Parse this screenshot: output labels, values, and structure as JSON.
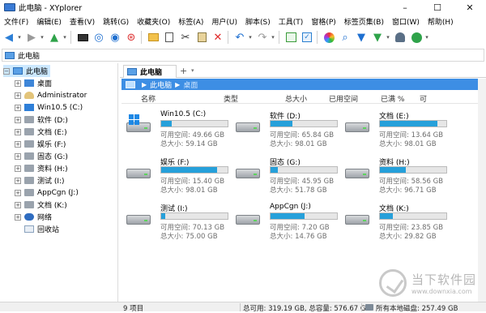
{
  "window": {
    "title": "此电脑 - XYplorer",
    "controls": [
      "–",
      "☐",
      "✕"
    ]
  },
  "menu": [
    "文件(F)",
    "编辑(E)",
    "查看(V)",
    "跳转(G)",
    "收藏夹(O)",
    "标签(A)",
    "用户(U)",
    "脚本(S)",
    "工具(T)",
    "窗格(P)",
    "标签页集(B)",
    "窗口(W)",
    "帮助(H)"
  ],
  "toolbar_icons": [
    "back-arrow-icon",
    "forward-arrow-icon",
    "up-arrow-icon",
    "computer-icon",
    "target-icon",
    "find-icon",
    "new-folder-icon",
    "copy-icon",
    "cut-icon",
    "paste-icon",
    "delete-icon",
    "undo-icon",
    "redo-icon",
    "tree-toggle-icon",
    "checkbox-icon",
    "color-wheel-icon",
    "search-icon",
    "filter-icon",
    "filter-green-icon",
    "ghost-icon",
    "visual-filter-icon"
  ],
  "address": {
    "path": "此电脑"
  },
  "tree": {
    "items": [
      {
        "label": "此电脑",
        "icon": "computer-icon",
        "expand": "−",
        "level": 0,
        "selected": true
      },
      {
        "label": "桌面",
        "icon": "desktop-icon",
        "expand": "+",
        "level": 1
      },
      {
        "label": "Administrator",
        "icon": "user-folder-icon",
        "expand": "+",
        "level": 1
      },
      {
        "label": "Win10.5 (C:)",
        "icon": "windows-drive-icon",
        "expand": "+",
        "level": 1
      },
      {
        "label": "软件 (D:)",
        "icon": "drive-icon",
        "expand": "+",
        "level": 1
      },
      {
        "label": "文档 (E:)",
        "icon": "drive-icon",
        "expand": "+",
        "level": 1
      },
      {
        "label": "娱乐 (F:)",
        "icon": "drive-icon",
        "expand": "+",
        "level": 1
      },
      {
        "label": "固态 (G:)",
        "icon": "drive-icon",
        "expand": "+",
        "level": 1
      },
      {
        "label": "资料 (H:)",
        "icon": "drive-icon",
        "expand": "+",
        "level": 1
      },
      {
        "label": "测试 (I:)",
        "icon": "drive-icon",
        "expand": "+",
        "level": 1
      },
      {
        "label": "AppCgn (J:)",
        "icon": "drive-icon",
        "expand": "+",
        "level": 1
      },
      {
        "label": "文档 (K:)",
        "icon": "drive-icon",
        "expand": "+",
        "level": 1
      },
      {
        "label": "网络",
        "icon": "network-icon",
        "expand": "+",
        "level": 1
      },
      {
        "label": "回收站",
        "icon": "recycle-bin-icon",
        "expand": "",
        "level": 1
      }
    ]
  },
  "tabs": [
    {
      "label": "此电脑"
    }
  ],
  "tab_add": "+",
  "tab_add_menu": "▾",
  "breadcrumb": {
    "root": "此电脑",
    "current": "桌面"
  },
  "columns": [
    "名称",
    "类型",
    "总大小",
    "已用空间",
    "已满 %",
    "可"
  ],
  "drives": [
    {
      "name": "Win10.5 (C:)",
      "free": "可用空间: 49.66 GB",
      "total": "总大小: 59.14 GB",
      "used_fraction": 0.16,
      "windows": true
    },
    {
      "name": "软件 (D:)",
      "free": "可用空间: 65.84 GB",
      "total": "总大小: 98.01 GB",
      "used_fraction": 0.33
    },
    {
      "name": "文档 (E:)",
      "free": "可用空间: 13.64 GB",
      "total": "总大小: 98.01 GB",
      "used_fraction": 0.86
    },
    {
      "name": "娱乐 (F:)",
      "free": "可用空间: 15.40 GB",
      "total": "总大小: 98.01 GB",
      "used_fraction": 0.84
    },
    {
      "name": "固态 (G:)",
      "free": "可用空间: 45.95 GB",
      "total": "总大小: 51.78 GB",
      "used_fraction": 0.11
    },
    {
      "name": "资料 (H:)",
      "free": "可用空间: 58.56 GB",
      "total": "总大小: 96.71 GB",
      "used_fraction": 0.39
    },
    {
      "name": "测试 (I:)",
      "free": "可用空间: 70.13 GB",
      "total": "总大小: 75.00 GB",
      "used_fraction": 0.06
    },
    {
      "name": "AppCgn (J:)",
      "free": "可用空间: 7.20 GB",
      "total": "总大小: 14.76 GB",
      "used_fraction": 0.51
    },
    {
      "name": "文档 (K:)",
      "free": "可用空间: 23.85 GB",
      "total": "总大小: 29.82 GB",
      "used_fraction": 0.2
    }
  ],
  "status": {
    "items": "9 项目",
    "capacity": "总可用: 319.19 GB, 总容量: 576.67 GB",
    "local": "所有本地磁盘: 257.49 GB"
  },
  "watermark": {
    "text": "当下软件园",
    "url": "www.downxia.com"
  },
  "colors": {
    "accent": "#3d8ee4",
    "bar_fill": "#26a0da",
    "selection": "#cce8ff"
  }
}
